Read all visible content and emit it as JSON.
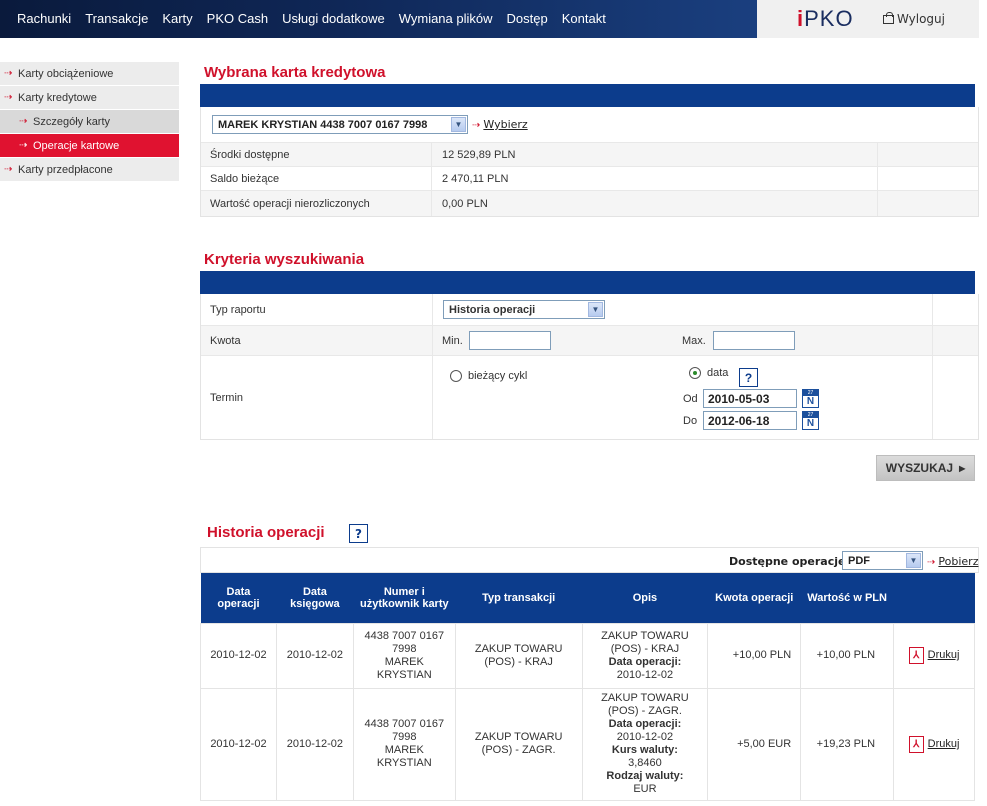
{
  "nav": {
    "items": [
      "Rachunki",
      "Transakcje",
      "Karty",
      "PKO Cash",
      "Usługi dodatkowe",
      "Wymiana plików",
      "Dostęp",
      "Kontakt"
    ],
    "logo_i": "i",
    "logo_text": "PKO",
    "logout": "Wyloguj"
  },
  "sidebar": {
    "items": [
      {
        "label": "Karty obciążeniowe"
      },
      {
        "label": "Karty kredytowe"
      },
      {
        "label": "Szczegóły karty"
      },
      {
        "label": "Operacje kartowe"
      },
      {
        "label": "Karty przedpłacone"
      }
    ]
  },
  "card": {
    "title": "Wybrana karta kredytowa",
    "selected": "MAREK KRYSTIAN 4438 7007 0167 7998",
    "choose_link": "Wybierz",
    "rows": [
      {
        "label": "Środki dostępne",
        "value": "12 529,89 PLN"
      },
      {
        "label": "Saldo bieżące",
        "value": "2 470,11 PLN"
      },
      {
        "label": "Wartość operacji nierozliczonych",
        "value": "0,00 PLN"
      }
    ]
  },
  "criteria": {
    "title": "Kryteria wyszukiwania",
    "report_label": "Typ raportu",
    "report_value": "Historia operacji",
    "amount_label": "Kwota",
    "min_label": "Min.",
    "max_label": "Max.",
    "term_label": "Termin",
    "current_cycle_label": "bieżący cykl",
    "date_label": "data",
    "from_label": "Od",
    "to_label": "Do",
    "from_value": "2010-05-03",
    "to_value": "2012-06-18",
    "help": "?",
    "calendar_day": "27",
    "search_button": "WYSZUKAJ"
  },
  "history": {
    "title": "Historia operacji",
    "help": "?",
    "ops_label": "Dostępne operacje:",
    "ops_value": "PDF",
    "download_link": "Pobierz",
    "headers": [
      "Data operacji",
      "Data księgowa",
      "Numer i użytkownik karty",
      "Typ transakcji",
      "Opis",
      "Kwota operacji",
      "Wartość w PLN",
      ""
    ],
    "print_label": "Drukuj",
    "rows": [
      {
        "op_date": "2010-12-02",
        "book_date": "2010-12-02",
        "card_lines": [
          "4438 7007 0167",
          "7998",
          "MAREK",
          "KRYSTIAN"
        ],
        "type_lines": [
          "ZAKUP TOWARU",
          "(POS) - KRAJ"
        ],
        "desc": [
          {
            "t": "ZAKUP TOWARU",
            "b": false
          },
          {
            "t": "(POS) - KRAJ",
            "b": false
          },
          {
            "t": "Data operacji:",
            "b": true
          },
          {
            "t": "2010-12-02",
            "b": false
          }
        ],
        "amount": "+10,00 PLN",
        "pln": "+10,00 PLN"
      },
      {
        "op_date": "2010-12-02",
        "book_date": "2010-12-02",
        "card_lines": [
          "4438 7007 0167",
          "7998",
          "MAREK",
          "KRYSTIAN"
        ],
        "type_lines": [
          "ZAKUP TOWARU",
          "(POS) - ZAGR."
        ],
        "desc": [
          {
            "t": "ZAKUP TOWARU",
            "b": false
          },
          {
            "t": "(POS) - ZAGR.",
            "b": false
          },
          {
            "t": "Data operacji:",
            "b": true
          },
          {
            "t": "2010-12-02",
            "b": false
          },
          {
            "t": "Kurs waluty:",
            "b": true
          },
          {
            "t": "3,8460",
            "b": false
          },
          {
            "t": "Rodzaj waluty:",
            "b": true
          },
          {
            "t": "EUR",
            "b": false
          }
        ],
        "amount": "+5,00 EUR",
        "pln": "+19,23 PLN"
      }
    ]
  },
  "colors": {
    "brand_red": "#d0112b",
    "brand_blue": "#0c3c8c",
    "nav_dark": "#0a1a3c"
  }
}
